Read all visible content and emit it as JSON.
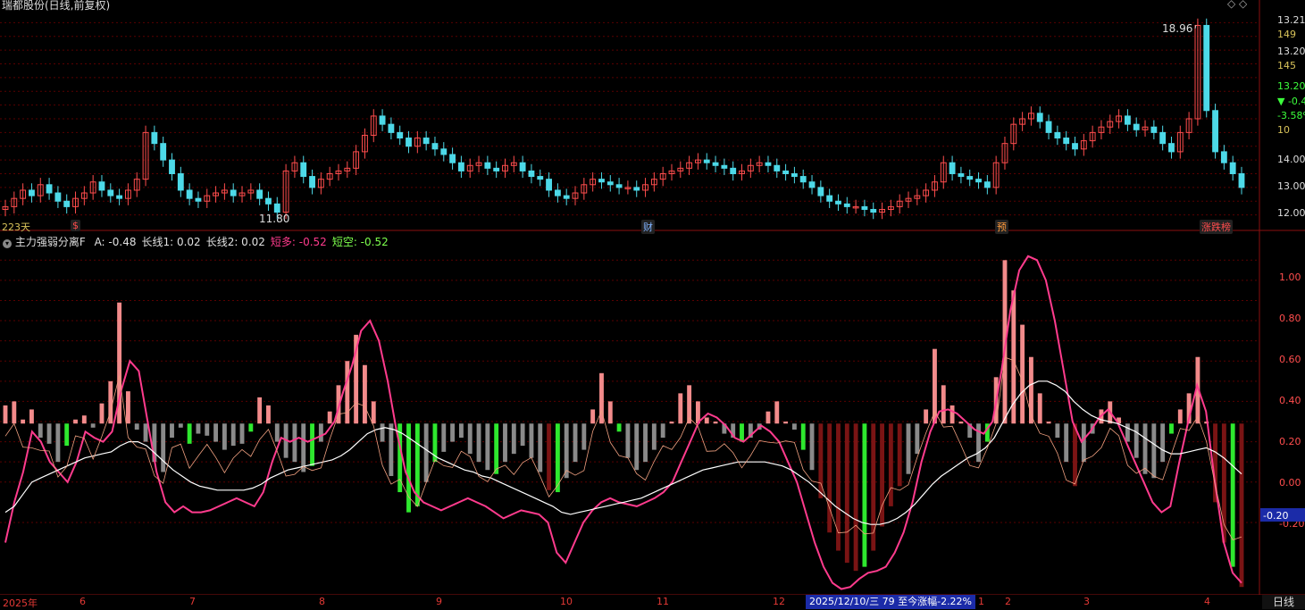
{
  "window": {
    "title": "瑞都股份(日线,前复权)",
    "bars_count_label": "223天",
    "period_label": "日线"
  },
  "price_panel": {
    "high_label": "18.96",
    "low_label": "11.80",
    "y_ticks": [
      "13.21",
      "149",
      "13.20",
      "145",
      "13.20",
      "▼ -0.49",
      "-3.58%",
      "10",
      "14.00",
      "13.00",
      "12.00"
    ],
    "event_markers": [
      {
        "text": "$",
        "color": "#ff4d4d"
      },
      {
        "text": "财",
        "color": "#7fb2ff"
      },
      {
        "text": "预",
        "color": "#ff9a3c"
      },
      {
        "text": "涨跌榜",
        "color": "#ff4d4d"
      }
    ]
  },
  "indicator_panel": {
    "name": "主力强弱分离F",
    "values": [
      {
        "label": "A: -0.48",
        "color": "#e0e0e0"
      },
      {
        "label": "长线1: 0.02",
        "color": "#e0e0e0"
      },
      {
        "label": "长线2: 0.02",
        "color": "#e0e0e0"
      },
      {
        "label": "短多: -0.52",
        "color": "#ff3b8d"
      },
      {
        "label": "短空: -0.52",
        "color": "#7dff4d"
      }
    ],
    "y_ticks": [
      "1.00",
      "0.80",
      "0.60",
      "0.40",
      "0.20",
      "0.00",
      "-0.20"
    ],
    "current_value": "-0.20"
  },
  "x_axis": {
    "labels": [
      "2025年",
      "6",
      "7",
      "8",
      "9",
      "10",
      "11",
      "12",
      "1",
      "2",
      "3",
      "4"
    ]
  },
  "status_text": "2025/12/10/三 79 至今涨幅-2.22%",
  "colors": {
    "up": "#ff4d4d",
    "down": "#4dd9e8",
    "bar_pos": "#f28b8b",
    "bar_neg_dark": "#7a1414",
    "bar_gray": "#8a8a8a",
    "bar_green": "#2ee82e",
    "grid": "#5a0000",
    "short_long": "#ff3b8d",
    "short_empty": "#7dff4d",
    "long_line": "#ffffff"
  },
  "chart_data": [
    {
      "type": "candlestick",
      "title": "瑞都股份(日线,前复权)",
      "ylim": [
        11.5,
        19.5
      ],
      "y_ticks": [
        12.0,
        13.0,
        14.0
      ],
      "close": [
        12.3,
        12.6,
        12.9,
        12.7,
        13.1,
        12.8,
        12.5,
        12.3,
        12.6,
        12.8,
        13.2,
        12.9,
        12.7,
        12.6,
        12.9,
        13.3,
        15.0,
        14.6,
        14.0,
        13.5,
        12.9,
        12.6,
        12.5,
        12.7,
        12.8,
        12.9,
        12.7,
        12.8,
        12.9,
        12.6,
        12.4,
        12.1,
        13.6,
        13.9,
        13.4,
        13.0,
        13.3,
        13.5,
        13.6,
        13.7,
        14.3,
        14.9,
        15.6,
        15.3,
        15.0,
        14.8,
        14.5,
        14.8,
        14.6,
        14.4,
        14.2,
        13.9,
        13.6,
        13.8,
        13.9,
        13.7,
        13.6,
        13.8,
        13.9,
        13.6,
        13.4,
        13.3,
        12.9,
        12.7,
        12.6,
        12.8,
        13.1,
        13.3,
        13.2,
        13.1,
        13.0,
        13.0,
        12.9,
        13.1,
        13.3,
        13.5,
        13.6,
        13.7,
        13.9,
        14.0,
        13.9,
        13.8,
        13.7,
        13.5,
        13.6,
        13.8,
        13.9,
        13.8,
        13.6,
        13.5,
        13.4,
        13.2,
        13.0,
        12.7,
        12.5,
        12.4,
        12.3,
        12.3,
        12.2,
        12.1,
        12.2,
        12.3,
        12.5,
        12.6,
        12.7,
        12.9,
        13.2,
        13.9,
        13.5,
        13.4,
        13.3,
        13.2,
        13.0,
        13.9,
        14.6,
        15.3,
        15.5,
        15.7,
        15.4,
        15.0,
        14.8,
        14.6,
        14.4,
        14.7,
        15.0,
        15.2,
        15.4,
        15.6,
        15.3,
        15.1,
        15.2,
        15.0,
        14.6,
        14.3,
        15.0,
        15.5,
        18.9,
        15.8,
        14.3,
        13.9,
        13.5,
        13.0
      ]
    },
    {
      "type": "bar",
      "title": "主力强弱分离F",
      "ylim": [
        -0.55,
        1.15
      ],
      "y_ticks": [
        -0.2,
        0.0,
        0.2,
        0.4,
        0.6,
        0.8,
        1.0
      ],
      "baseline": 0.29,
      "values": [
        0.38,
        0.4,
        0.31,
        0.36,
        0.22,
        0.19,
        0.1,
        0.18,
        0.31,
        0.33,
        0.27,
        0.39,
        0.5,
        0.89,
        0.45,
        0.26,
        0.2,
        0.1,
        0.05,
        0.22,
        0.27,
        0.19,
        0.24,
        0.23,
        0.2,
        0.16,
        0.18,
        0.19,
        0.25,
        0.42,
        0.38,
        0.2,
        0.12,
        0.1,
        0.05,
        0.08,
        0.2,
        0.35,
        0.48,
        0.6,
        0.73,
        0.58,
        0.4,
        0.2,
        0.03,
        -0.05,
        -0.15,
        -0.12,
        0.0,
        0.1,
        0.15,
        0.2,
        0.22,
        0.14,
        0.1,
        0.06,
        0.04,
        0.1,
        0.14,
        0.18,
        0.12,
        0.05,
        -0.04,
        -0.05,
        0.02,
        0.1,
        0.16,
        0.36,
        0.54,
        0.4,
        0.25,
        0.12,
        0.06,
        0.1,
        0.16,
        0.22,
        0.3,
        0.44,
        0.48,
        0.4,
        0.32,
        0.3,
        0.24,
        0.22,
        0.2,
        0.22,
        0.26,
        0.35,
        0.4,
        0.3,
        0.26,
        0.16,
        0.06,
        -0.08,
        -0.25,
        -0.34,
        -0.4,
        -0.44,
        -0.42,
        -0.34,
        -0.22,
        -0.12,
        -0.02,
        0.04,
        0.14,
        0.36,
        0.66,
        0.48,
        0.38,
        0.3,
        0.22,
        0.1,
        0.2,
        0.52,
        1.1,
        0.95,
        0.78,
        0.62,
        0.44,
        0.3,
        0.22,
        0.1,
        -0.02,
        0.1,
        0.24,
        0.36,
        0.4,
        0.32,
        0.2,
        0.12,
        0.04,
        0.02,
        0.1,
        0.24,
        0.36,
        0.44,
        0.62,
        0.3,
        -0.1,
        -0.3,
        -0.42,
        -0.52
      ]
    },
    {
      "type": "line",
      "series": [
        {
          "name": "短多",
          "values": [
            -0.3,
            -0.1,
            0.05,
            0.25,
            0.2,
            0.1,
            0.05,
            0.0,
            0.1,
            0.25,
            0.22,
            0.2,
            0.25,
            0.45,
            0.6,
            0.55,
            0.3,
            0.05,
            -0.1,
            -0.15,
            -0.12,
            -0.15,
            -0.15,
            -0.14,
            -0.12,
            -0.1,
            -0.08,
            -0.1,
            -0.12,
            -0.05,
            0.1,
            0.22,
            0.2,
            0.22,
            0.2,
            0.22,
            0.24,
            0.3,
            0.45,
            0.58,
            0.75,
            0.8,
            0.7,
            0.5,
            0.25,
            0.05,
            -0.05,
            -0.1,
            -0.12,
            -0.14,
            -0.12,
            -0.1,
            -0.08,
            -0.1,
            -0.12,
            -0.15,
            -0.18,
            -0.16,
            -0.14,
            -0.15,
            -0.16,
            -0.2,
            -0.35,
            -0.4,
            -0.3,
            -0.2,
            -0.14,
            -0.1,
            -0.08,
            -0.1,
            -0.11,
            -0.12,
            -0.1,
            -0.08,
            -0.05,
            0.0,
            0.1,
            0.2,
            0.3,
            0.34,
            0.32,
            0.28,
            0.22,
            0.2,
            0.24,
            0.28,
            0.25,
            0.2,
            0.1,
            0.0,
            -0.15,
            -0.3,
            -0.42,
            -0.5,
            -0.53,
            -0.52,
            -0.48,
            -0.45,
            -0.44,
            -0.42,
            -0.35,
            -0.25,
            -0.1,
            0.1,
            0.25,
            0.35,
            0.36,
            0.34,
            0.3,
            0.26,
            0.24,
            0.3,
            0.55,
            0.85,
            1.05,
            1.12,
            1.1,
            1.0,
            0.8,
            0.55,
            0.3,
            0.2,
            0.25,
            0.32,
            0.36,
            0.3,
            0.2,
            0.1,
            0.0,
            -0.1,
            -0.15,
            -0.12,
            0.1,
            0.3,
            0.48,
            0.35,
            0.0,
            -0.3,
            -0.45,
            -0.5
          ]
        },
        {
          "name": "长线",
          "values": [
            -0.15,
            -0.12,
            -0.06,
            0.0,
            0.02,
            0.04,
            0.06,
            0.08,
            0.1,
            0.12,
            0.13,
            0.14,
            0.15,
            0.18,
            0.2,
            0.2,
            0.18,
            0.14,
            0.1,
            0.06,
            0.03,
            0.0,
            -0.02,
            -0.03,
            -0.04,
            -0.04,
            -0.04,
            -0.04,
            -0.03,
            -0.01,
            0.02,
            0.04,
            0.06,
            0.07,
            0.08,
            0.09,
            0.1,
            0.11,
            0.13,
            0.16,
            0.2,
            0.24,
            0.26,
            0.27,
            0.26,
            0.24,
            0.21,
            0.18,
            0.15,
            0.12,
            0.1,
            0.08,
            0.06,
            0.05,
            0.03,
            0.02,
            0.0,
            -0.02,
            -0.04,
            -0.06,
            -0.08,
            -0.1,
            -0.12,
            -0.15,
            -0.16,
            -0.15,
            -0.14,
            -0.13,
            -0.12,
            -0.11,
            -0.1,
            -0.09,
            -0.08,
            -0.06,
            -0.04,
            -0.02,
            0.0,
            0.02,
            0.04,
            0.06,
            0.07,
            0.08,
            0.09,
            0.1,
            0.1,
            0.1,
            0.1,
            0.09,
            0.08,
            0.06,
            0.03,
            0.0,
            -0.04,
            -0.08,
            -0.12,
            -0.15,
            -0.18,
            -0.2,
            -0.21,
            -0.21,
            -0.2,
            -0.18,
            -0.15,
            -0.11,
            -0.06,
            -0.01,
            0.03,
            0.06,
            0.09,
            0.12,
            0.14,
            0.17,
            0.22,
            0.3,
            0.38,
            0.44,
            0.48,
            0.5,
            0.5,
            0.48,
            0.45,
            0.4,
            0.36,
            0.33,
            0.31,
            0.3,
            0.29,
            0.27,
            0.25,
            0.22,
            0.19,
            0.16,
            0.14,
            0.14,
            0.15,
            0.16,
            0.17,
            0.15,
            0.12,
            0.08,
            0.04
          ]
        }
      ]
    }
  ]
}
